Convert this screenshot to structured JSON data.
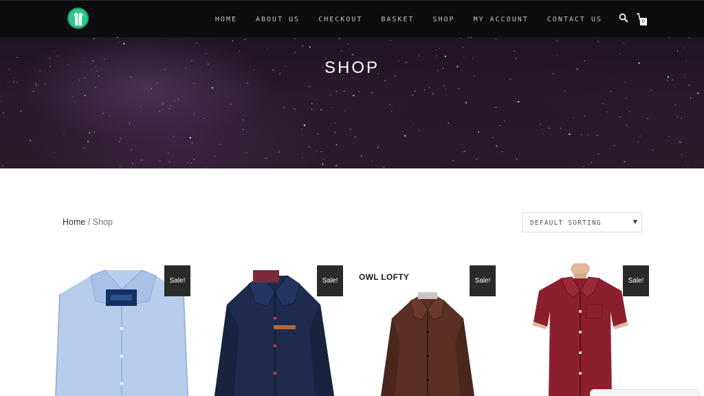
{
  "nav": {
    "logo_icon": "coat-logo-icon",
    "items": [
      {
        "label": "HOME"
      },
      {
        "label": "ABOUT US"
      },
      {
        "label": "CHECKOUT"
      },
      {
        "label": "BASKET"
      },
      {
        "label": "SHOP"
      },
      {
        "label": "MY ACCOUNT"
      },
      {
        "label": "CONTACT US"
      }
    ],
    "search_icon": "search-icon",
    "cart_icon": "cart-icon",
    "cart_count": "0"
  },
  "hero": {
    "title": "SHOP"
  },
  "breadcrumb": {
    "home": "Home",
    "separator": " / ",
    "current": "Shop"
  },
  "sort": {
    "selected": "DEFAULT SORTING"
  },
  "products": [
    {
      "badge": "Sale!",
      "image": "light-blue-dress-shirt",
      "brand_text": ""
    },
    {
      "badge": "Sale!",
      "image": "navy-denim-shirt",
      "brand_text": ""
    },
    {
      "badge": "Sale!",
      "image": "brown-dress-shirt",
      "brand_text": "OWL LOFTY"
    },
    {
      "badge": "Sale!",
      "image": "burgundy-short-sleeve-shirt",
      "brand_text": ""
    }
  ],
  "colors": {
    "navbar_bg": "#0d0d10",
    "nav_text": "#bfc3c8",
    "logo_green": "#2ec98a",
    "badge_bg": "#2a2a2a"
  }
}
